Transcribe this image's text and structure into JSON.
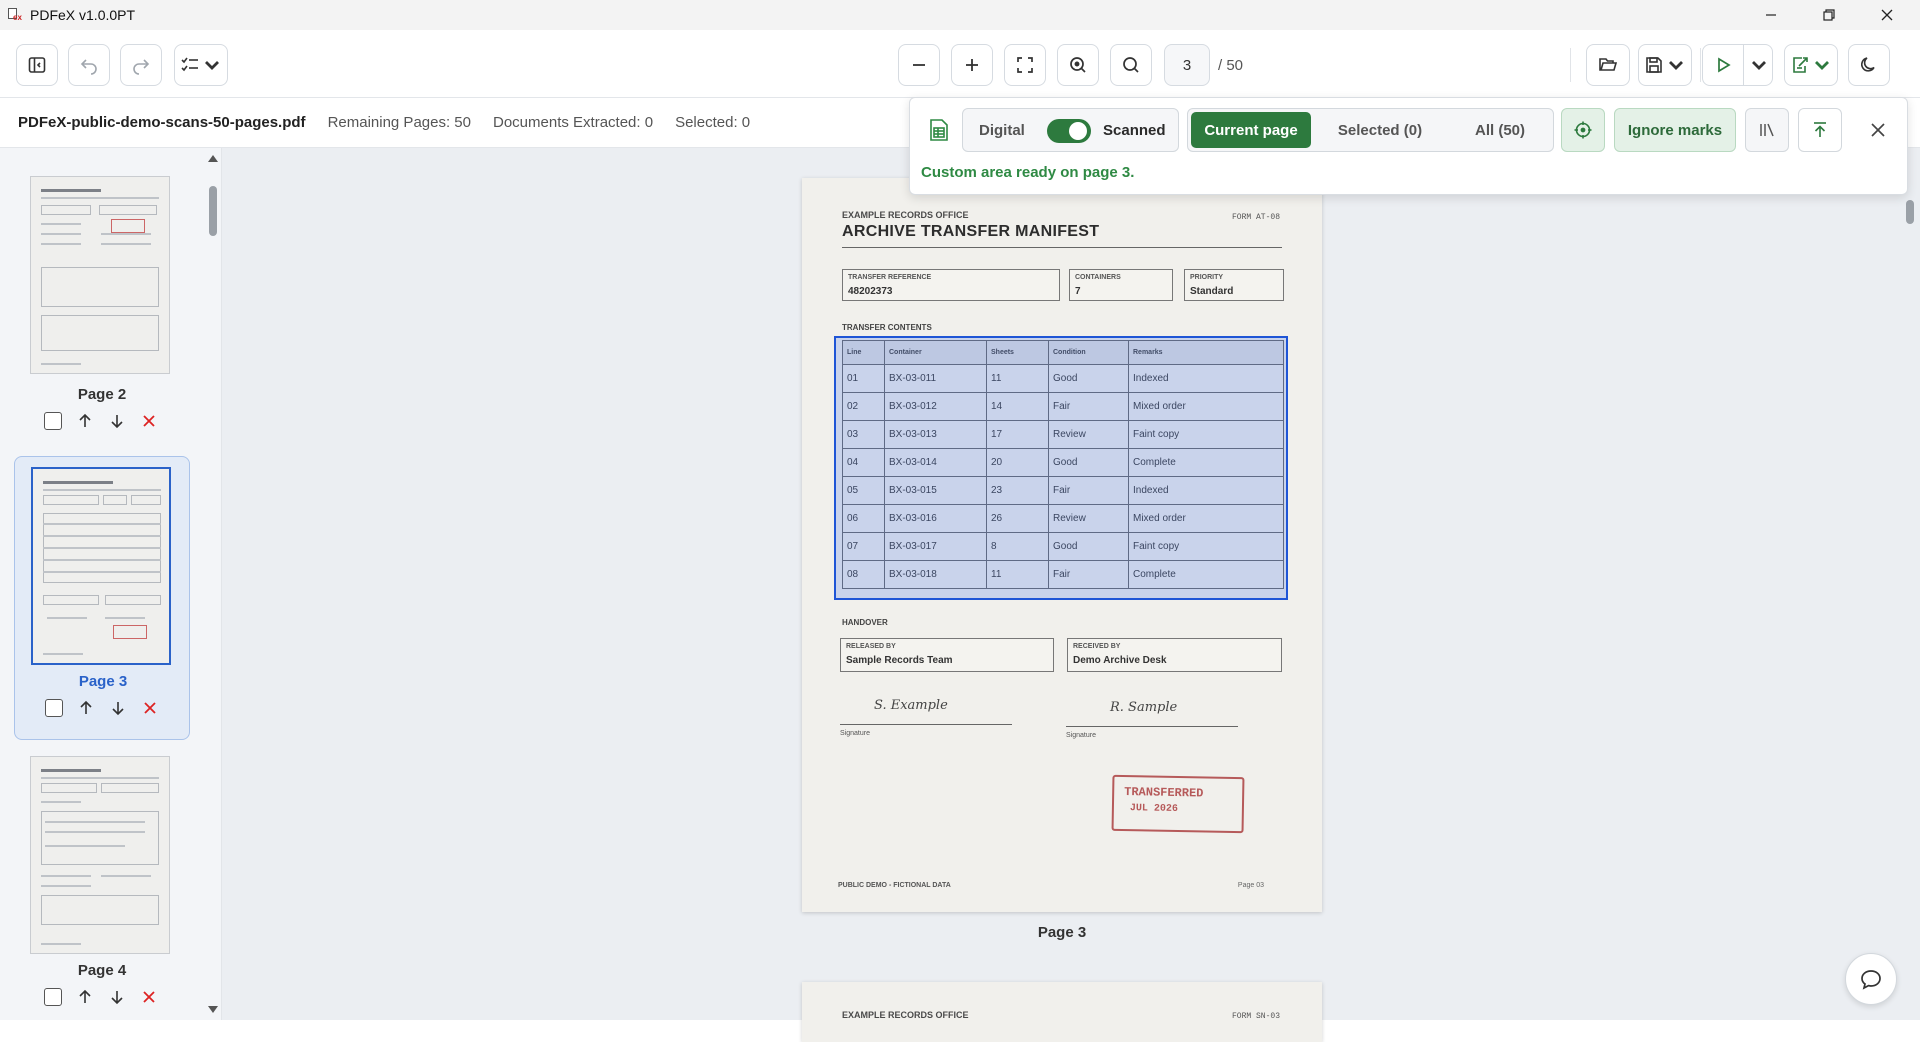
{
  "window": {
    "title": "PDFeX v1.0.0PT",
    "logo_text": "ex"
  },
  "toolbar": {
    "current_page": "3",
    "total_pages": "/ 50",
    "icons": [
      "sidebar-toggle-icon",
      "undo-icon",
      "redo-icon",
      "checklist-icon",
      "zoom-out-icon",
      "zoom-in-icon",
      "fit-page-icon",
      "zoom-reset-icon",
      "search-icon",
      "open-folder-icon",
      "save-icon",
      "run-icon",
      "export-icon",
      "dark-mode-icon"
    ]
  },
  "infobar": {
    "filename": "PDFeX-public-demo-scans-50-pages.pdf",
    "remaining": "Remaining Pages: 50",
    "extracted": "Documents Extracted: 0",
    "selected": "Selected: 0"
  },
  "sidebar": {
    "pages": [
      {
        "label": "Page 2",
        "active": false
      },
      {
        "label": "Page 3",
        "active": true
      },
      {
        "label": "Page 4",
        "active": false
      }
    ]
  },
  "panel": {
    "mode_digital": "Digital",
    "mode_scanned": "Scanned",
    "scanned_enabled": true,
    "scope_current": "Current page",
    "scope_selected": "Selected (0)",
    "scope_all": "All (50)",
    "active_scope": "Current page",
    "ignore_marks": "Ignore marks",
    "status": "Custom area ready on page 3."
  },
  "document": {
    "office": "EXAMPLE RECORDS OFFICE",
    "form_id": "FORM AT-08",
    "title": "ARCHIVE TRANSFER MANIFEST",
    "fields": [
      {
        "label": "TRANSFER REFERENCE",
        "value": "48202373"
      },
      {
        "label": "CONTAINERS",
        "value": "7"
      },
      {
        "label": "PRIORITY",
        "value": "Standard"
      }
    ],
    "contents_heading": "TRANSFER CONTENTS",
    "table_headers": [
      "Line",
      "Container",
      "Sheets",
      "Condition",
      "Remarks"
    ],
    "table_rows": [
      [
        "01",
        "BX-03-011",
        "11",
        "Good",
        "Indexed"
      ],
      [
        "02",
        "BX-03-012",
        "14",
        "Fair",
        "Mixed order"
      ],
      [
        "03",
        "BX-03-013",
        "17",
        "Review",
        "Faint copy"
      ],
      [
        "04",
        "BX-03-014",
        "20",
        "Good",
        "Complete"
      ],
      [
        "05",
        "BX-03-015",
        "23",
        "Fair",
        "Indexed"
      ],
      [
        "06",
        "BX-03-016",
        "26",
        "Review",
        "Mixed order"
      ],
      [
        "07",
        "BX-03-017",
        "8",
        "Good",
        "Faint copy"
      ],
      [
        "08",
        "BX-03-018",
        "11",
        "Fair",
        "Complete"
      ]
    ],
    "handover_heading": "HANDOVER",
    "released_label": "RELEASED BY",
    "released_value": "Sample Records Team",
    "received_label": "RECEIVED BY",
    "received_value": "Demo Archive Desk",
    "signature_1": "S. Example",
    "signature_2": "R. Sample",
    "signature_label": "Signature",
    "stamp_line1": "TRANSFERRED",
    "stamp_line2": "JUL 2026",
    "footer": "PUBLIC DEMO - FICTIONAL DATA",
    "page_no": "Page 03",
    "caption": "Page 3"
  },
  "next_document": {
    "office": "EXAMPLE RECORDS OFFICE",
    "form_id": "FORM SN-03"
  },
  "colors": {
    "accent_green": "#2d7a3e",
    "selection_blue": "#1f55d6",
    "delete_red": "#d22222"
  }
}
